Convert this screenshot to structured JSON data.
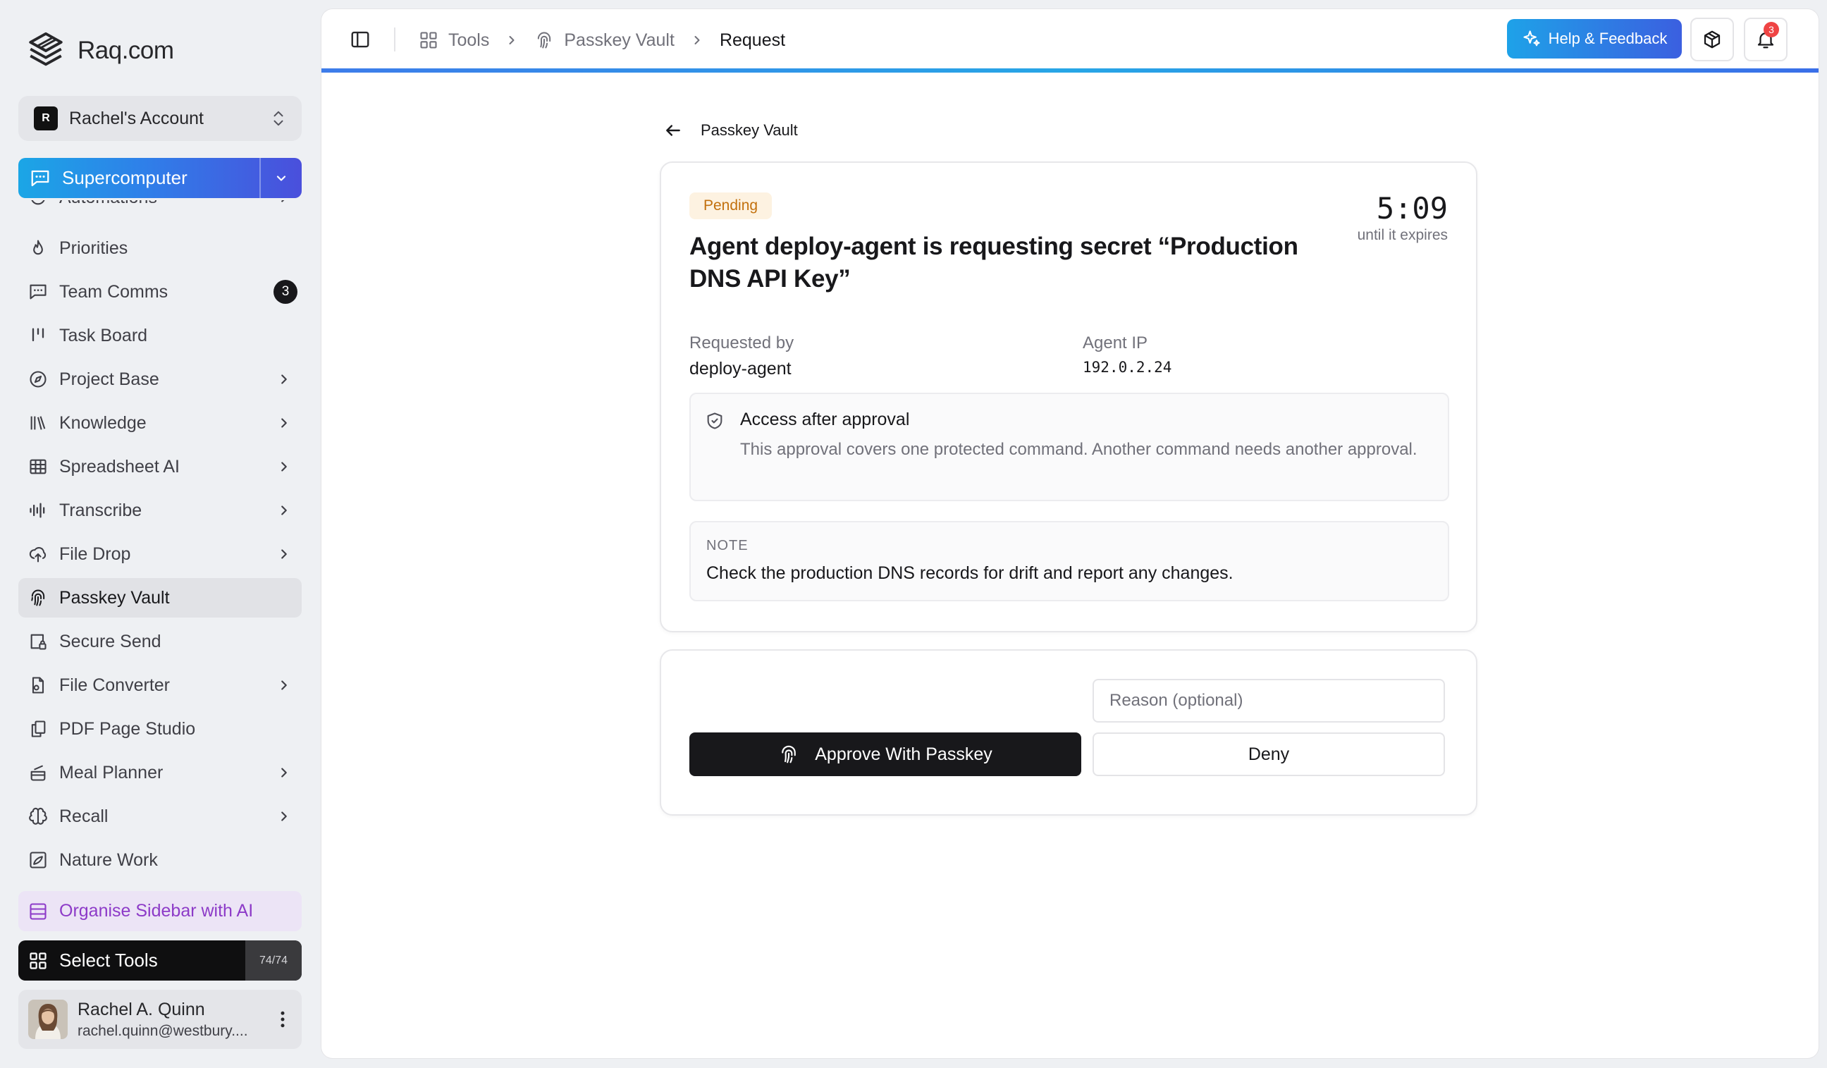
{
  "brand": {
    "name": "Raq.com"
  },
  "account": {
    "initial": "R",
    "name": "Rachel's Account"
  },
  "supercomputer": {
    "label": "Supercomputer"
  },
  "sidebar": {
    "items": [
      {
        "label": "Automations",
        "icon": "automations-icon",
        "chevron": true
      },
      {
        "label": "Priorities",
        "icon": "flame-icon"
      },
      {
        "label": "Team Comms",
        "icon": "chat-icon",
        "count": "3"
      },
      {
        "label": "Task Board",
        "icon": "kanban-icon"
      },
      {
        "label": "Project Base",
        "icon": "compass-icon",
        "chevron": true
      },
      {
        "label": "Knowledge",
        "icon": "library-icon",
        "chevron": true
      },
      {
        "label": "Spreadsheet AI",
        "icon": "table-icon",
        "chevron": true
      },
      {
        "label": "Transcribe",
        "icon": "waveform-icon",
        "chevron": true
      },
      {
        "label": "File Drop",
        "icon": "cloud-upload-icon",
        "chevron": true
      },
      {
        "label": "Passkey Vault",
        "icon": "fingerprint-icon",
        "active": true
      },
      {
        "label": "Secure Send",
        "icon": "secure-send-icon"
      },
      {
        "label": "File Converter",
        "icon": "file-convert-icon",
        "chevron": true
      },
      {
        "label": "PDF Page Studio",
        "icon": "pages-icon"
      },
      {
        "label": "Meal Planner",
        "icon": "cooking-pot-icon",
        "chevron": true
      },
      {
        "label": "Recall",
        "icon": "brain-icon",
        "chevron": true
      },
      {
        "label": "Nature Work",
        "icon": "nature-icon"
      }
    ],
    "organise_label": "Organise Sidebar with AI",
    "select_tools_label": "Select Tools",
    "select_tools_count": "74/74"
  },
  "user": {
    "name": "Rachel A. Quinn",
    "email": "rachel.quinn@westbury...."
  },
  "topbar": {
    "breadcrumb": [
      "Tools",
      "Passkey Vault",
      "Request"
    ],
    "help_label": "Help & Feedback",
    "notification_count": "3"
  },
  "page": {
    "back_label": "Passkey Vault",
    "status": "Pending",
    "title": "Agent deploy-agent is requesting secret “Production DNS API Key”",
    "timer": "5:09",
    "timer_caption": "until it expires",
    "requested_by_label": "Requested by",
    "requested_by": "deploy-agent",
    "agent_ip_label": "Agent IP",
    "agent_ip": "192.0.2.24",
    "access_title": "Access after approval",
    "access_desc": "This approval covers one protected command. Another command needs another approval.",
    "note_label": "NOTE",
    "note_text": "Check the production DNS records for drift and report any changes.",
    "reason_placeholder": "Reason (optional)",
    "approve_label": "Approve With Passkey",
    "deny_label": "Deny"
  },
  "colors": {
    "accent_gradient_start": "#1ba6e6",
    "accent_gradient_end": "#4a4fdc",
    "pending_bg": "#fdf2e1",
    "pending_text": "#c2700d",
    "organise_text": "#8d3bc8",
    "notification": "#ef4444"
  }
}
